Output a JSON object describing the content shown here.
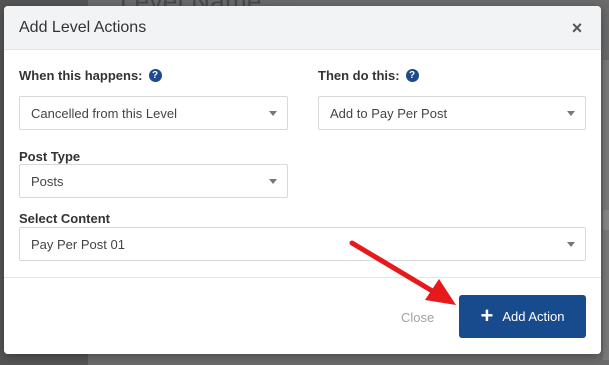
{
  "background": {
    "header_text": "Level Name",
    "value_text": "Silver"
  },
  "modal": {
    "title": "Add Level Actions",
    "close_glyph": "×",
    "when_label": "When this happens:",
    "when_help_glyph": "?",
    "when_value": "Cancelled from this Level",
    "then_label": "Then do this:",
    "then_help_glyph": "?",
    "then_value": "Add to Pay Per Post",
    "post_type_label": "Post Type",
    "post_type_value": "Posts",
    "content_label": "Select Content",
    "content_value": "Pay Per Post 01",
    "footer": {
      "close_label": "Close",
      "add_label": "Add Action",
      "add_icon": "plus-icon"
    }
  },
  "colors": {
    "primary": "#184a8e",
    "annotation_arrow": "#e8191a"
  }
}
